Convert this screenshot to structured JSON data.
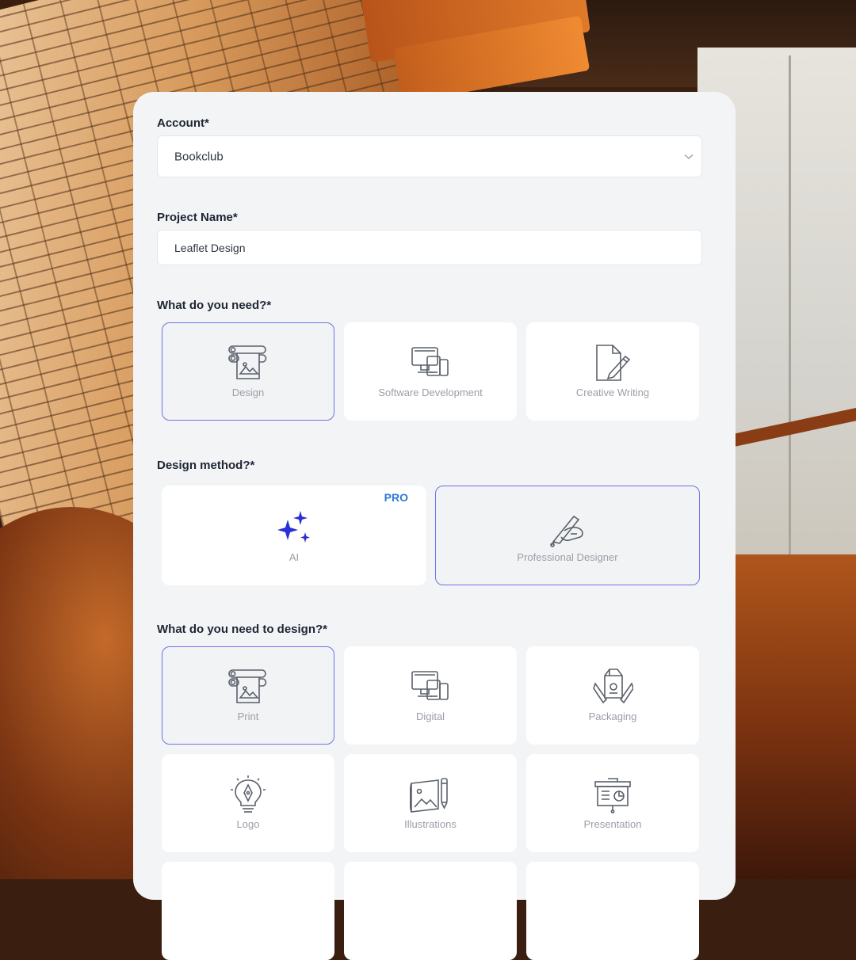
{
  "account": {
    "label": "Account*",
    "value": "Bookclub"
  },
  "project": {
    "label": "Project Name*",
    "value": "Leaflet Design"
  },
  "need": {
    "label": "What do you need?*",
    "options": [
      {
        "label": "Design",
        "icon": "print-roll-icon",
        "selected": true
      },
      {
        "label": "Software Development",
        "icon": "devices-icon",
        "selected": false
      },
      {
        "label": "Creative Writing",
        "icon": "document-pencil-icon",
        "selected": false
      }
    ]
  },
  "method": {
    "label": "Design method?*",
    "options": [
      {
        "label": "AI",
        "icon": "sparkles-icon",
        "badge": "PRO",
        "selected": false
      },
      {
        "label": "Professional Designer",
        "icon": "hand-pen-icon",
        "selected": true
      }
    ]
  },
  "design_type": {
    "label": "What do you need to design?*",
    "options": [
      {
        "label": "Print",
        "icon": "print-roll-icon",
        "selected": true
      },
      {
        "label": "Digital",
        "icon": "devices-icon",
        "selected": false
      },
      {
        "label": "Packaging",
        "icon": "packaging-icon",
        "selected": false
      },
      {
        "label": "Logo",
        "icon": "lightbulb-pen-icon",
        "selected": false
      },
      {
        "label": "Illustrations",
        "icon": "illustration-icon",
        "selected": false
      },
      {
        "label": "Presentation",
        "icon": "presentation-board-icon",
        "selected": false
      }
    ]
  },
  "colors": {
    "accent_border": "#6e72e6",
    "pro_badge": "#2e7bd6",
    "ai_sparkle": "#2b2fd6"
  }
}
